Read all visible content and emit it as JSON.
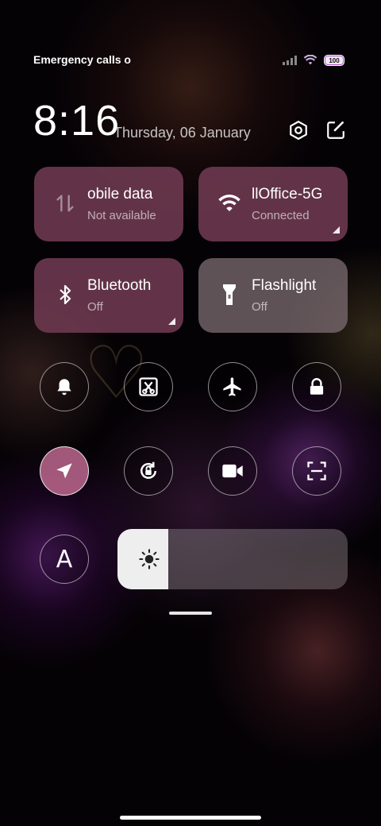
{
  "status_bar": {
    "carrier_text": "Emergency calls o",
    "battery_level": "100"
  },
  "header": {
    "time": "8:16",
    "date": "Thursday, 06 January",
    "settings_icon": "hexagon-settings-icon",
    "edit_icon": "edit-icon"
  },
  "tiles": [
    {
      "title": "obile data",
      "subtitle": "Not available",
      "icon": "mobile-data-icon",
      "active": false
    },
    {
      "title": "llOffice-5G",
      "subtitle": "Connected",
      "icon": "wifi-icon",
      "active": true
    },
    {
      "title": "Bluetooth",
      "subtitle": "Off",
      "icon": "bluetooth-icon",
      "active": false
    },
    {
      "title": "Flashlight",
      "subtitle": "Off",
      "icon": "flashlight-icon",
      "active": false
    }
  ],
  "toggles_row1": [
    "bell-icon",
    "screenshot-icon",
    "airplane-icon",
    "lock-icon"
  ],
  "toggles_row2": [
    "location-icon",
    "rotation-lock-icon",
    "video-icon",
    "scan-icon"
  ],
  "auto_text_toggle": {
    "label": "A",
    "icon": "auto-text-icon"
  },
  "brightness": {
    "level": 0.22,
    "icon": "sun-icon"
  },
  "colors": {
    "tile_active": "#703a52",
    "tile_light": "#7d6e73",
    "toggle_active": "#c86e96"
  }
}
